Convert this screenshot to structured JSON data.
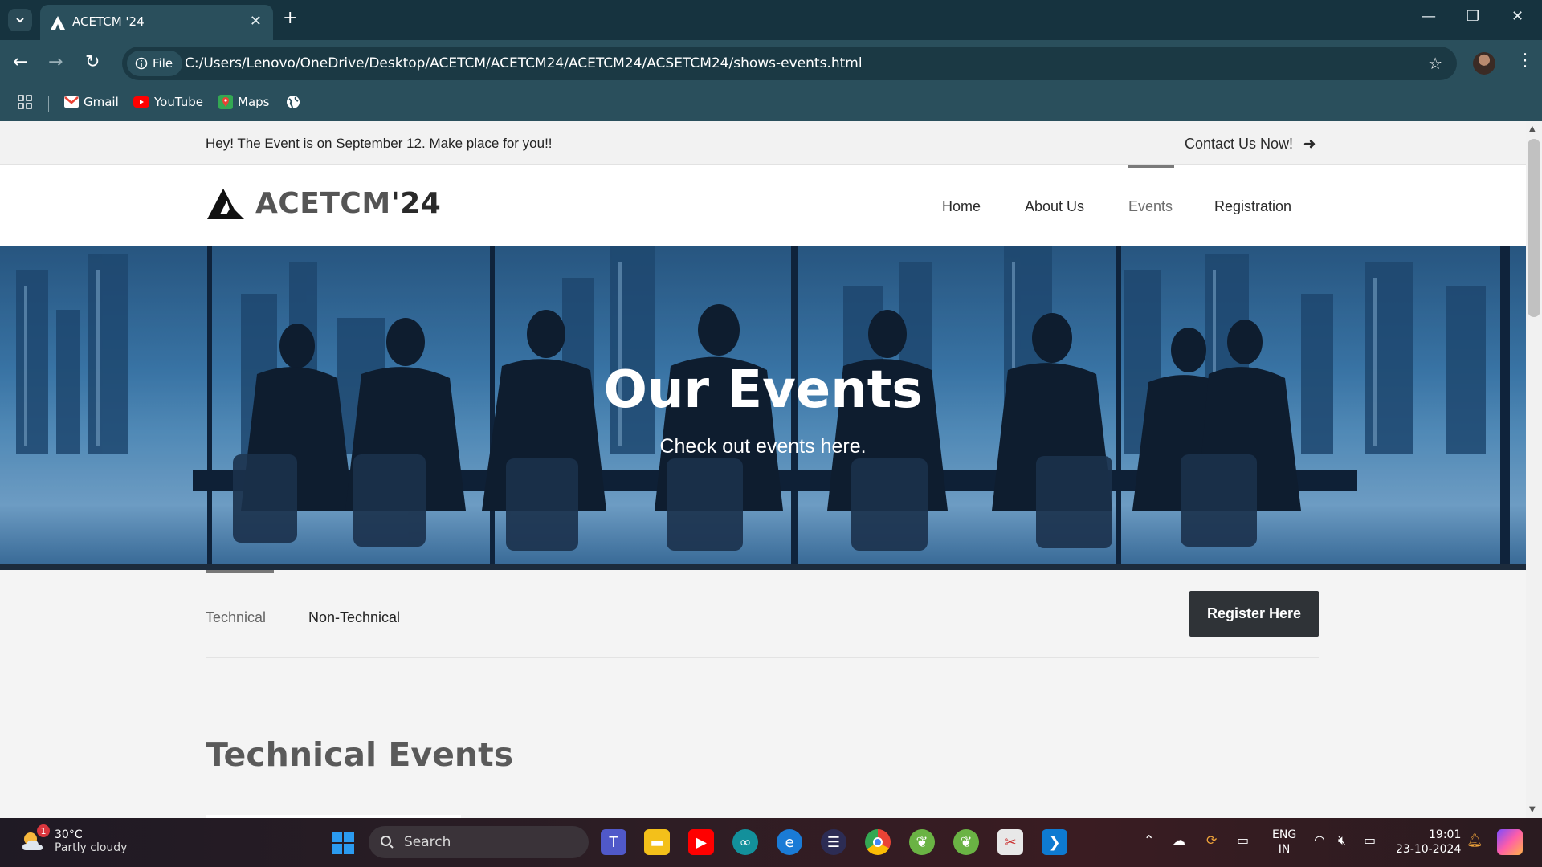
{
  "browser": {
    "tab_title": "ACETCM '24",
    "url_chip": "File",
    "url": "C:/Users/Lenovo/OneDrive/Desktop/ACETCM/ACETCM24/ACETCM24/ACSETCM24/shows-events.html",
    "bookmarks": [
      {
        "label": "Gmail",
        "icon": "gmail-icon"
      },
      {
        "label": "YouTube",
        "icon": "youtube-icon"
      },
      {
        "label": "Maps",
        "icon": "maps-icon"
      }
    ]
  },
  "page": {
    "announcement": "Hey! The Event is on September 12. Make place for you!!",
    "contact_link": "Contact Us Now!",
    "logo_text_main": "ACETCM",
    "logo_text_suffix": "'24",
    "nav": [
      {
        "label": "Home"
      },
      {
        "label": "About Us"
      },
      {
        "label": "Events",
        "active": true
      },
      {
        "label": "Registration"
      }
    ],
    "hero_title": "Our Events",
    "hero_subtitle": "Check out events here.",
    "event_tabs": [
      {
        "label": "Technical",
        "active": true
      },
      {
        "label": "Non-Technical"
      }
    ],
    "register_button": "Register Here",
    "section_title": "Technical Events"
  },
  "taskbar": {
    "weather_temp": "30°C",
    "weather_condition": "Partly cloudy",
    "weather_badge": "1",
    "search_placeholder": "Search",
    "lang_line1": "ENG",
    "lang_line2": "IN",
    "time": "19:01",
    "date": "23-10-2024"
  },
  "colors": {
    "chrome_frame": "#16333f",
    "chrome_toolbar": "#2a4f5c",
    "register_button_bg": "#2f3337",
    "hero_overlay": "#3f7fb2"
  }
}
